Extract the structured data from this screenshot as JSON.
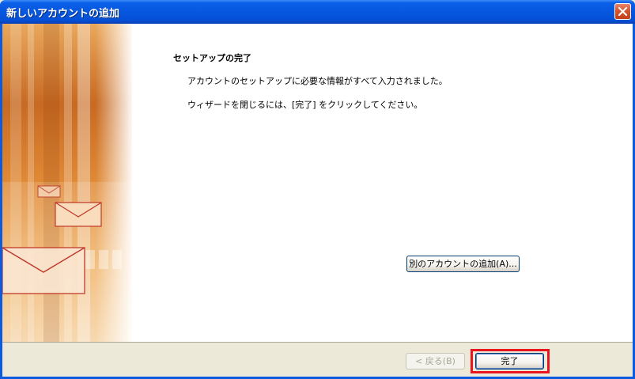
{
  "window": {
    "title": "新しいアカウントの追加"
  },
  "content": {
    "heading": "セットアップの完了",
    "message1": "アカウントのセットアップに必要な情報がすべて入力されました。",
    "message2": "ウィザードを閉じるには、[完了] をクリックしてください。",
    "add_account_label": "別のアカウントの追加(A)..."
  },
  "footer": {
    "back_label": "< 戻る(B)",
    "finish_label": "完了"
  },
  "colors": {
    "titlebar": "#0757e0",
    "highlight": "#e8141e",
    "art_orange": "#d9782a"
  }
}
